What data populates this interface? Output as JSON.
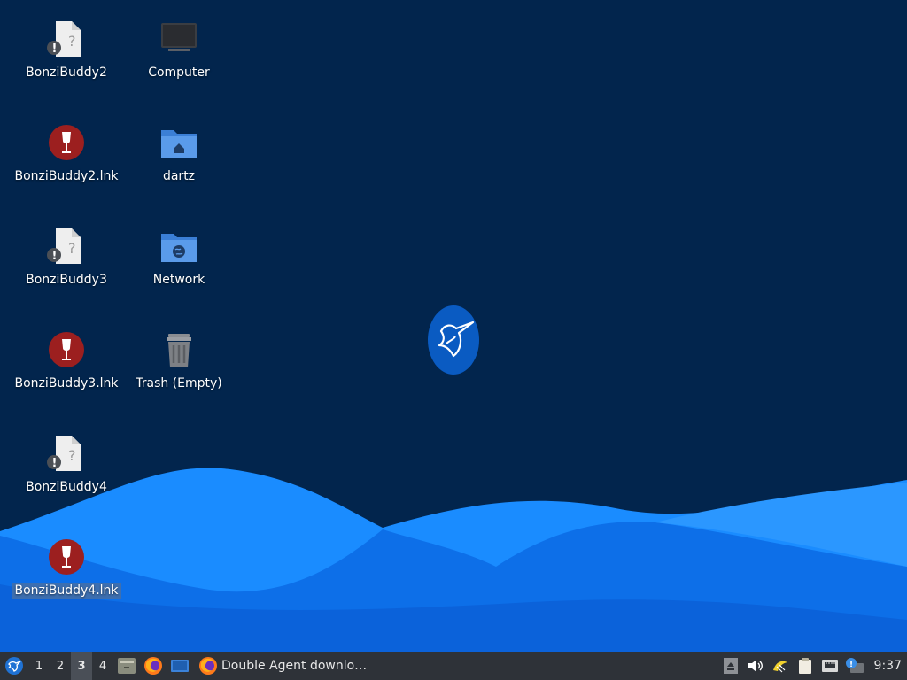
{
  "desktop": {
    "icons": [
      {
        "id": "bonzi2",
        "label": "BonziBuddy2",
        "icon": "unknown-file-icon"
      },
      {
        "id": "bonzi2lnk",
        "label": "BonziBuddy2.lnk",
        "icon": "wine-icon"
      },
      {
        "id": "bonzi3",
        "label": "BonziBuddy3",
        "icon": "unknown-file-icon"
      },
      {
        "id": "bonzi3lnk",
        "label": "BonziBuddy3.lnk",
        "icon": "wine-icon"
      },
      {
        "id": "bonzi4",
        "label": "BonziBuddy4",
        "icon": "unknown-file-icon"
      },
      {
        "id": "bonzi4lnk",
        "label": "BonziBuddy4.lnk",
        "icon": "wine-icon",
        "selected": true
      },
      {
        "id": "computer",
        "label": "Computer",
        "icon": "computer-icon"
      },
      {
        "id": "dartz",
        "label": "dartz",
        "icon": "home-folder-icon"
      },
      {
        "id": "network",
        "label": "Network",
        "icon": "network-folder-icon"
      },
      {
        "id": "trash",
        "label": "Trash (Empty)",
        "icon": "trash-icon"
      }
    ],
    "wallpaper_logo": "hummingbird-logo",
    "colors": {
      "background": "#02254d",
      "wave_light": "#1a8cff",
      "wave_dark": "#0b5fd6",
      "selection": "#3d6fb0"
    }
  },
  "taskbar": {
    "start_icon": "start-menu-icon",
    "workspaces": [
      "1",
      "2",
      "3",
      "4"
    ],
    "active_workspace": "3",
    "launchers": [
      "file-manager-icon",
      "firefox-icon",
      "desktop-icon"
    ],
    "tasks": [
      {
        "title": "Double Agent downlo…",
        "icon": "firefox-icon"
      }
    ],
    "tray": [
      "eject-icon",
      "volume-icon",
      "wine-tray-icon",
      "clipboard-icon",
      "network-icon",
      "update-notifier-icon"
    ],
    "clock": "9:37"
  }
}
